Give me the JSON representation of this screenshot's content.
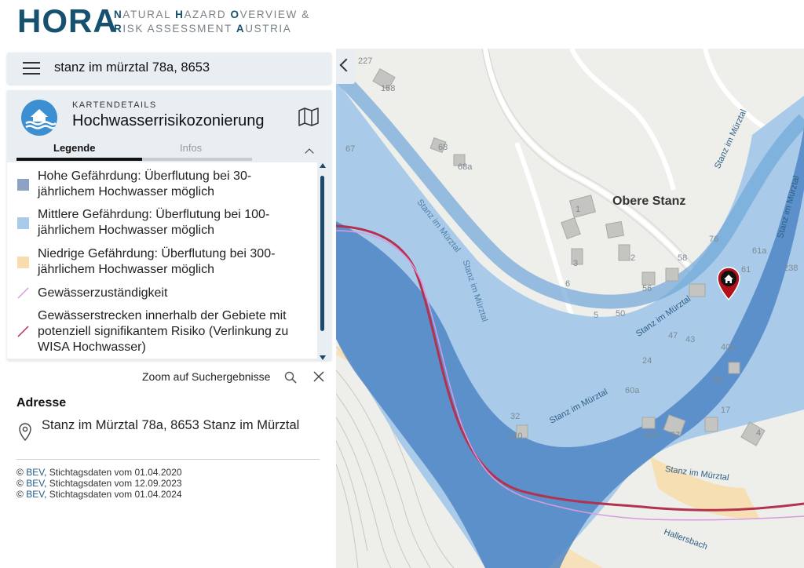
{
  "header": {
    "logo": "HORA",
    "tagline_line1": [
      "N",
      "ATURAL ",
      "H",
      "AZARD ",
      "O",
      "VERVIEW &"
    ],
    "tagline_line2": [
      "R",
      "ISK ASSESSMENT ",
      "A",
      "USTRIA"
    ]
  },
  "search": {
    "value": "stanz im mürztal 78a, 8653",
    "menu_icon": "hamburger-menu-icon"
  },
  "details": {
    "label": "KARTENDETAILS",
    "title": "Hochwasserrisikozonierung",
    "logo_icon": "flood-house-icon",
    "map_icon": "map-icon",
    "tabs": [
      {
        "label": "Legende",
        "active": true
      },
      {
        "label": "Infos",
        "active": false
      }
    ]
  },
  "legend": [
    {
      "text": "Hohe Gefährdung: Überflutung bei 30-jährlichem Hochwasser möglich",
      "color": "#8ea3c4",
      "kind": "box"
    },
    {
      "text": "Mittlere Gefährdung: Überflutung bei 100-jährlichem Hochwasser möglich",
      "color": "#a9cbe9",
      "kind": "box"
    },
    {
      "text": "Niedrige Gefährdung: Überflutung bei 300-jährlichem Hochwasser möglich",
      "color": "#f7ddae",
      "kind": "box"
    },
    {
      "text": "Gewässerzuständigkeit",
      "color": "#d89be0",
      "kind": "line"
    },
    {
      "text": "Gewässerstrecken innerhalb der Gebiete mit potenziell signifikantem Risiko (Verlinkung zu WISA Hochwasser)",
      "color": "#b2324f",
      "kind": "line"
    }
  ],
  "result": {
    "zoom_label": "Zoom auf Suchergebnisse",
    "address_heading": "Adresse",
    "address": "Stanz im Mürztal 78a, 8653 Stanz im Mürztal",
    "attributions": [
      {
        "link": "BEV",
        "text": ", Stichtagsdaten vom 01.04.2020"
      },
      {
        "link": "BEV",
        "text": ", Stichtagsdaten vom 12.09.2023"
      },
      {
        "link": "BEV",
        "text": ", Stichtagsdaten vom 01.04.2024"
      }
    ]
  },
  "map": {
    "place_label": "Obere Stanz",
    "street_labels": [
      "Stanz im Mürztal",
      "Stanz im Mürztal",
      "Stanz im Mürztal",
      "Stanz im Mürztal",
      "Stanz im Mürztal",
      "Stanz im Mürztal",
      "Stanz im Mürztal",
      "Hallersbach"
    ],
    "house_numbers": [
      "227",
      "158",
      "68",
      "68a",
      "1",
      "2",
      "3",
      "6",
      "56",
      "58",
      "76",
      "50",
      "5",
      "61a",
      "61",
      "238",
      "47",
      "43",
      "40a",
      "24",
      "32",
      "46",
      "17",
      "60a",
      "100",
      "57",
      "4",
      "110",
      "67"
    ],
    "marker_icon": "home-marker-icon"
  }
}
